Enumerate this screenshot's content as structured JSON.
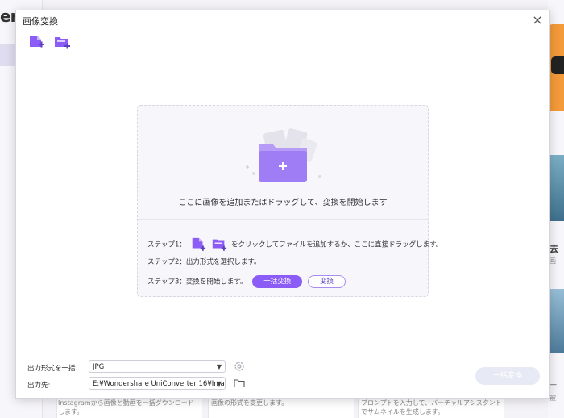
{
  "background": {
    "brand_fragment": "ert",
    "right_tile_title": "去",
    "right_tile_sub": "画",
    "right_tile3_title": "—",
    "right_tile3_sub": "被",
    "bottom_col1": "Instagramから画像と動画を一括ダウンロードします。",
    "bottom_col2": "画像の形式を変更します。",
    "bottom_col3": "プロンプトを入力して、バーチャルアシスタントでサムネイルを生成します。"
  },
  "dialog": {
    "title": "画像変換",
    "close_label": "×"
  },
  "toolbar": {
    "add_file_icon": "add-file-icon",
    "add_folder_icon": "add-folder-icon"
  },
  "drop_zone": {
    "main_text": "ここに画像を追加またはドラッグして、変換を開始します",
    "step1_prefix": "ステップ1：",
    "step1_suffix": "をクリックしてファイルを追加するか、ここに直接ドラッグします。",
    "step2": "ステップ2：出力形式を選択します。",
    "step3_prefix": "ステップ3：変換を開始します。",
    "convert_all_label": "一括変換",
    "convert_label": "変換"
  },
  "bottom": {
    "format_label": "出力形式を一括...",
    "format_value": "JPG",
    "output_label": "出力先:",
    "output_value": "E:¥Wondershare UniConverter 16¥Ima",
    "convert_all_label": "一括変換"
  },
  "colors": {
    "accent": "#8b5cf6",
    "accent_light": "#b79cf7",
    "disabled_button": "#e7eaf4"
  }
}
